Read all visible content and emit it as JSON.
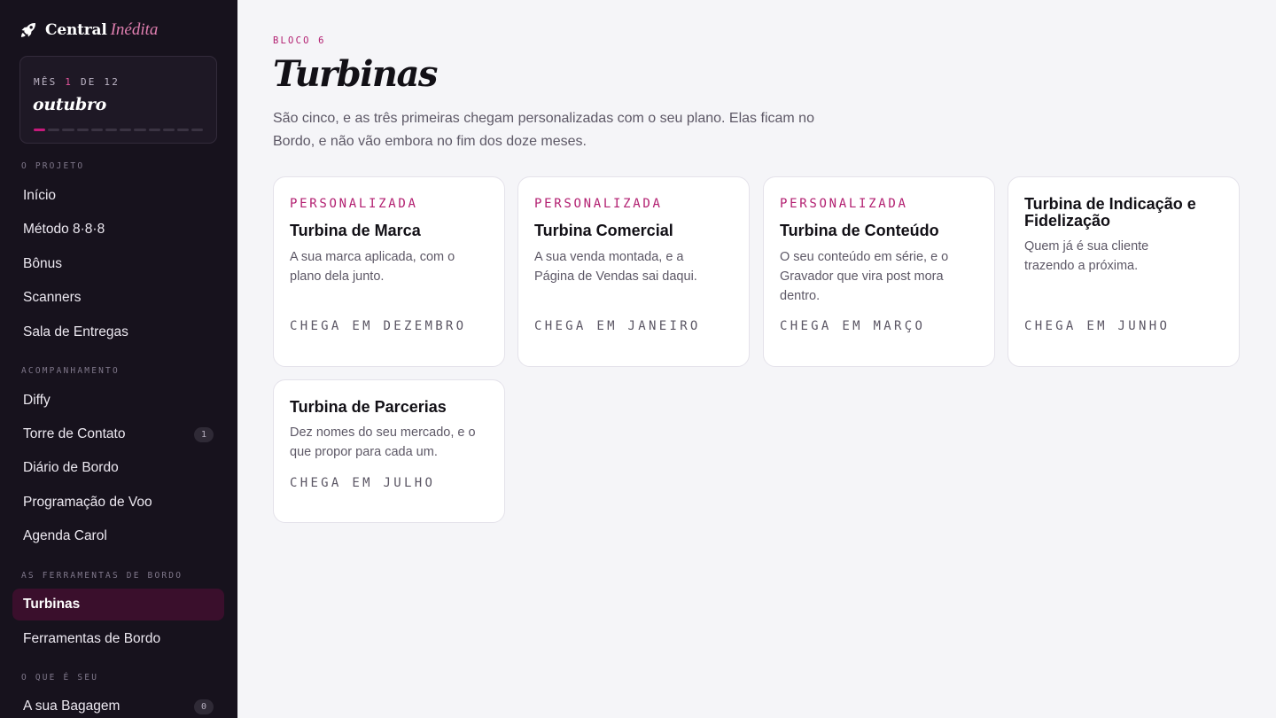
{
  "brand": {
    "name": "Central",
    "accent": "Inédita",
    "icon": "rocket-icon"
  },
  "month": {
    "label_prefix": "MÊS ",
    "current": "1",
    "label_suffix": " DE 12",
    "name": "outubro",
    "progress": {
      "current": 1,
      "total": 12
    }
  },
  "nav": {
    "sections": [
      {
        "title": "O PROJETO",
        "items": [
          {
            "label": "Início"
          },
          {
            "label": "Método 8·8·8"
          },
          {
            "label": "Bônus"
          },
          {
            "label": "Scanners"
          },
          {
            "label": "Sala de Entregas"
          }
        ]
      },
      {
        "title": "ACOMPANHAMENTO",
        "items": [
          {
            "label": "Diffy"
          },
          {
            "label": "Torre de Contato",
            "badge": "1"
          },
          {
            "label": "Diário de Bordo"
          },
          {
            "label": "Programação de Voo"
          },
          {
            "label": "Agenda Carol"
          }
        ]
      },
      {
        "title": "AS FERRAMENTAS DE BORDO",
        "items": [
          {
            "label": "Turbinas",
            "active": true
          },
          {
            "label": "Ferramentas de Bordo"
          }
        ]
      },
      {
        "title": "O QUE É SEU",
        "items": [
          {
            "label": "A sua Bagagem",
            "badge": "0"
          }
        ]
      }
    ]
  },
  "page": {
    "eyebrow": "BLOCO 6",
    "title": "Turbinas",
    "description": "São cinco, e as três primeiras chegam personalizadas com o seu plano. Elas ficam no Bordo, e não vão embora no fim dos doze meses."
  },
  "cards": [
    {
      "tag": "PERSONALIZADA",
      "title": "Turbina de Marca",
      "text": "A sua marca aplicada, com o plano dela junto.",
      "arrival": "CHEGA EM DEZEMBRO"
    },
    {
      "tag": "PERSONALIZADA",
      "title": "Turbina Comercial",
      "text": "A sua venda montada, e a Página de Vendas sai daqui.",
      "arrival": "CHEGA EM JANEIRO"
    },
    {
      "tag": "PERSONALIZADA",
      "title": "Turbina de Conteúdo",
      "text": "O seu conteúdo em série, e o Gravador que vira post mora dentro.",
      "arrival": "CHEGA EM MARÇO"
    },
    {
      "tag": "",
      "title": "Turbina de Indicação e Fidelização",
      "text": "Quem já é sua cliente trazendo a próxima.",
      "arrival": "CHEGA EM JUNHO"
    },
    {
      "tag": "",
      "title": "Turbina de Parcerias",
      "text": "Dez nomes do seu mercado, e o que propor para cada um.",
      "arrival": "CHEGA EM JULHO"
    }
  ],
  "colors": {
    "sidebar_bg": "#17121d",
    "accent": "#b21e70",
    "active_bg": "#3a0f2c",
    "page_bg": "#f5f5f8"
  }
}
